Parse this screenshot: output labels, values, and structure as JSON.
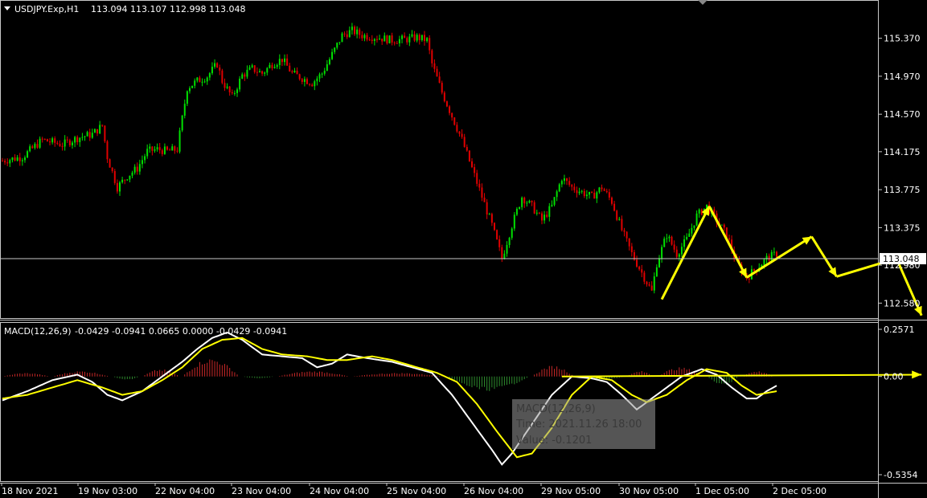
{
  "header": {
    "symbol": "USDJPY.Exp,H1",
    "ohlc": "113.094 113.107 112.998 113.048"
  },
  "macd_header": {
    "name": "MACD(12,26,9)",
    "values": "-0.0429 -0.0941 0.0665 0.0000 -0.0429 -0.0941"
  },
  "tooltip": {
    "line1": "MACD(12,26,9)",
    "line2": "Time: 2021.11.26 18:00",
    "line3": "Value: -0.1201"
  },
  "colors": {
    "bull": "#00e000",
    "bear": "#e00000",
    "hist_pos": "#c82828",
    "hist_neg": "#2e8b2e",
    "arrow": "#ffff00",
    "grid": "#c8c8c8"
  },
  "chart_data": [
    {
      "type": "candlestick",
      "x_labels": [
        "18 Nov 2021",
        "19 Nov 03:00",
        "22 Nov 04:00",
        "23 Nov 04:00",
        "24 Nov 04:00",
        "25 Nov 04:00",
        "26 Nov 04:00",
        "29 Nov 05:00",
        "30 Nov 05:00",
        "1 Dec 05:00",
        "2 Dec 05:00"
      ],
      "y_ticks": [
        "115.370",
        "114.970",
        "114.570",
        "114.175",
        "113.775",
        "113.375",
        "112.980",
        "112.580"
      ],
      "ylim": [
        112.49,
        115.57
      ],
      "current_price": "113.048",
      "close_path": [
        [
          0,
          114.08
        ],
        [
          8,
          114.12
        ],
        [
          16,
          114.3
        ],
        [
          24,
          114.25
        ],
        [
          30,
          114.32
        ],
        [
          36,
          114.36
        ],
        [
          40,
          114.45
        ],
        [
          42,
          114.12
        ],
        [
          46,
          113.8
        ],
        [
          50,
          113.92
        ],
        [
          54,
          114.0
        ],
        [
          58,
          114.18
        ],
        [
          62,
          114.2
        ],
        [
          66,
          114.18
        ],
        [
          70,
          114.2
        ],
        [
          74,
          114.85
        ],
        [
          78,
          114.92
        ],
        [
          82,
          114.97
        ],
        [
          86,
          115.1
        ],
        [
          88,
          114.92
        ],
        [
          92,
          114.75
        ],
        [
          96,
          114.98
        ],
        [
          100,
          115.05
        ],
        [
          104,
          115.0
        ],
        [
          108,
          115.1
        ],
        [
          112,
          115.15
        ],
        [
          116,
          115.0
        ],
        [
          120,
          114.95
        ],
        [
          124,
          114.9
        ],
        [
          128,
          115.0
        ],
        [
          132,
          115.2
        ],
        [
          136,
          115.4
        ],
        [
          140,
          115.45
        ],
        [
          144,
          115.4
        ],
        [
          150,
          115.38
        ],
        [
          156,
          115.35
        ],
        [
          162,
          115.36
        ],
        [
          166,
          115.38
        ],
        [
          170,
          115.35
        ],
        [
          172,
          115.1
        ],
        [
          176,
          114.8
        ],
        [
          180,
          114.55
        ],
        [
          184,
          114.3
        ],
        [
          188,
          114.0
        ],
        [
          192,
          113.7
        ],
        [
          196,
          113.4
        ],
        [
          200,
          113.05
        ],
        [
          204,
          113.4
        ],
        [
          208,
          113.7
        ],
        [
          212,
          113.6
        ],
        [
          216,
          113.45
        ],
        [
          220,
          113.6
        ],
        [
          224,
          113.9
        ],
        [
          228,
          113.8
        ],
        [
          232,
          113.75
        ],
        [
          236,
          113.7
        ],
        [
          240,
          113.8
        ],
        [
          244,
          113.65
        ],
        [
          248,
          113.35
        ],
        [
          252,
          113.1
        ],
        [
          256,
          112.9
        ],
        [
          260,
          112.7
        ],
        [
          262,
          113.0
        ],
        [
          266,
          113.3
        ],
        [
          270,
          113.1
        ],
        [
          274,
          113.25
        ],
        [
          278,
          113.5
        ],
        [
          282,
          113.6
        ],
        [
          286,
          113.45
        ],
        [
          290,
          113.3
        ],
        [
          294,
          113.0
        ],
        [
          298,
          112.85
        ],
        [
          302,
          112.95
        ],
        [
          306,
          113.05
        ],
        [
          310,
          113.1
        ]
      ],
      "future_path": [
        [
          264,
          112.62
        ],
        [
          283,
          113.6
        ],
        [
          298,
          112.85
        ],
        [
          324,
          113.28
        ],
        [
          334,
          112.86
        ],
        [
          358,
          113.05
        ],
        [
          368,
          112.45
        ]
      ],
      "n_bars": 311
    },
    {
      "type": "macd",
      "ylim": [
        -0.5354,
        0.2571
      ],
      "y_ticks": [
        "0.2571",
        "0.00",
        "-0.5354"
      ],
      "macd_path": [
        [
          0,
          -0.13
        ],
        [
          10,
          -0.08
        ],
        [
          20,
          -0.02
        ],
        [
          30,
          0.01
        ],
        [
          36,
          -0.03
        ],
        [
          42,
          -0.1
        ],
        [
          48,
          -0.13
        ],
        [
          56,
          -0.08
        ],
        [
          64,
          0.0
        ],
        [
          72,
          0.08
        ],
        [
          78,
          0.15
        ],
        [
          84,
          0.21
        ],
        [
          90,
          0.24
        ],
        [
          96,
          0.2
        ],
        [
          104,
          0.12
        ],
        [
          112,
          0.11
        ],
        [
          120,
          0.1
        ],
        [
          126,
          0.05
        ],
        [
          132,
          0.07
        ],
        [
          138,
          0.12
        ],
        [
          146,
          0.1
        ],
        [
          156,
          0.08
        ],
        [
          164,
          0.05
        ],
        [
          172,
          0.02
        ],
        [
          180,
          -0.1
        ],
        [
          188,
          -0.25
        ],
        [
          196,
          -0.4
        ],
        [
          200,
          -0.48
        ],
        [
          204,
          -0.42
        ],
        [
          212,
          -0.26
        ],
        [
          220,
          -0.1
        ],
        [
          228,
          0.0
        ],
        [
          236,
          -0.01
        ],
        [
          242,
          -0.03
        ],
        [
          248,
          -0.1
        ],
        [
          254,
          -0.18
        ],
        [
          260,
          -0.12
        ],
        [
          266,
          -0.06
        ],
        [
          272,
          0.0
        ],
        [
          280,
          0.04
        ],
        [
          286,
          0.01
        ],
        [
          292,
          -0.06
        ],
        [
          298,
          -0.12
        ],
        [
          302,
          -0.12
        ],
        [
          306,
          -0.08
        ],
        [
          310,
          -0.05
        ]
      ],
      "signal_path": [
        [
          0,
          -0.12
        ],
        [
          10,
          -0.1
        ],
        [
          20,
          -0.06
        ],
        [
          30,
          -0.02
        ],
        [
          40,
          -0.06
        ],
        [
          48,
          -0.1
        ],
        [
          56,
          -0.08
        ],
        [
          64,
          -0.02
        ],
        [
          72,
          0.05
        ],
        [
          80,
          0.15
        ],
        [
          88,
          0.2
        ],
        [
          96,
          0.21
        ],
        [
          104,
          0.15
        ],
        [
          112,
          0.12
        ],
        [
          122,
          0.11
        ],
        [
          130,
          0.09
        ],
        [
          138,
          0.09
        ],
        [
          148,
          0.11
        ],
        [
          156,
          0.09
        ],
        [
          166,
          0.05
        ],
        [
          174,
          0.02
        ],
        [
          182,
          -0.03
        ],
        [
          190,
          -0.15
        ],
        [
          198,
          -0.3
        ],
        [
          206,
          -0.44
        ],
        [
          212,
          -0.42
        ],
        [
          220,
          -0.28
        ],
        [
          228,
          -0.1
        ],
        [
          236,
          0.0
        ],
        [
          244,
          -0.02
        ],
        [
          252,
          -0.1
        ],
        [
          258,
          -0.14
        ],
        [
          266,
          -0.1
        ],
        [
          274,
          -0.02
        ],
        [
          282,
          0.04
        ],
        [
          290,
          0.02
        ],
        [
          296,
          -0.05
        ],
        [
          302,
          -0.1
        ],
        [
          310,
          -0.08
        ]
      ],
      "hist_segments": [
        [
          0,
          20,
          0.02
        ],
        [
          20,
          44,
          0.03
        ],
        [
          44,
          56,
          -0.02
        ],
        [
          56,
          72,
          0.04
        ],
        [
          72,
          96,
          0.1
        ],
        [
          96,
          110,
          -0.01
        ],
        [
          110,
          140,
          0.03
        ],
        [
          140,
          178,
          0.02
        ],
        [
          178,
          212,
          -0.08
        ],
        [
          212,
          230,
          0.06
        ],
        [
          230,
          250,
          -0.02
        ],
        [
          250,
          262,
          0.03
        ],
        [
          262,
          282,
          0.05
        ],
        [
          282,
          296,
          -0.05
        ],
        [
          296,
          310,
          0.03
        ]
      ],
      "zero_trendline": [
        [
          224,
          0.0
        ],
        [
          368,
          0.01
        ]
      ]
    }
  ]
}
